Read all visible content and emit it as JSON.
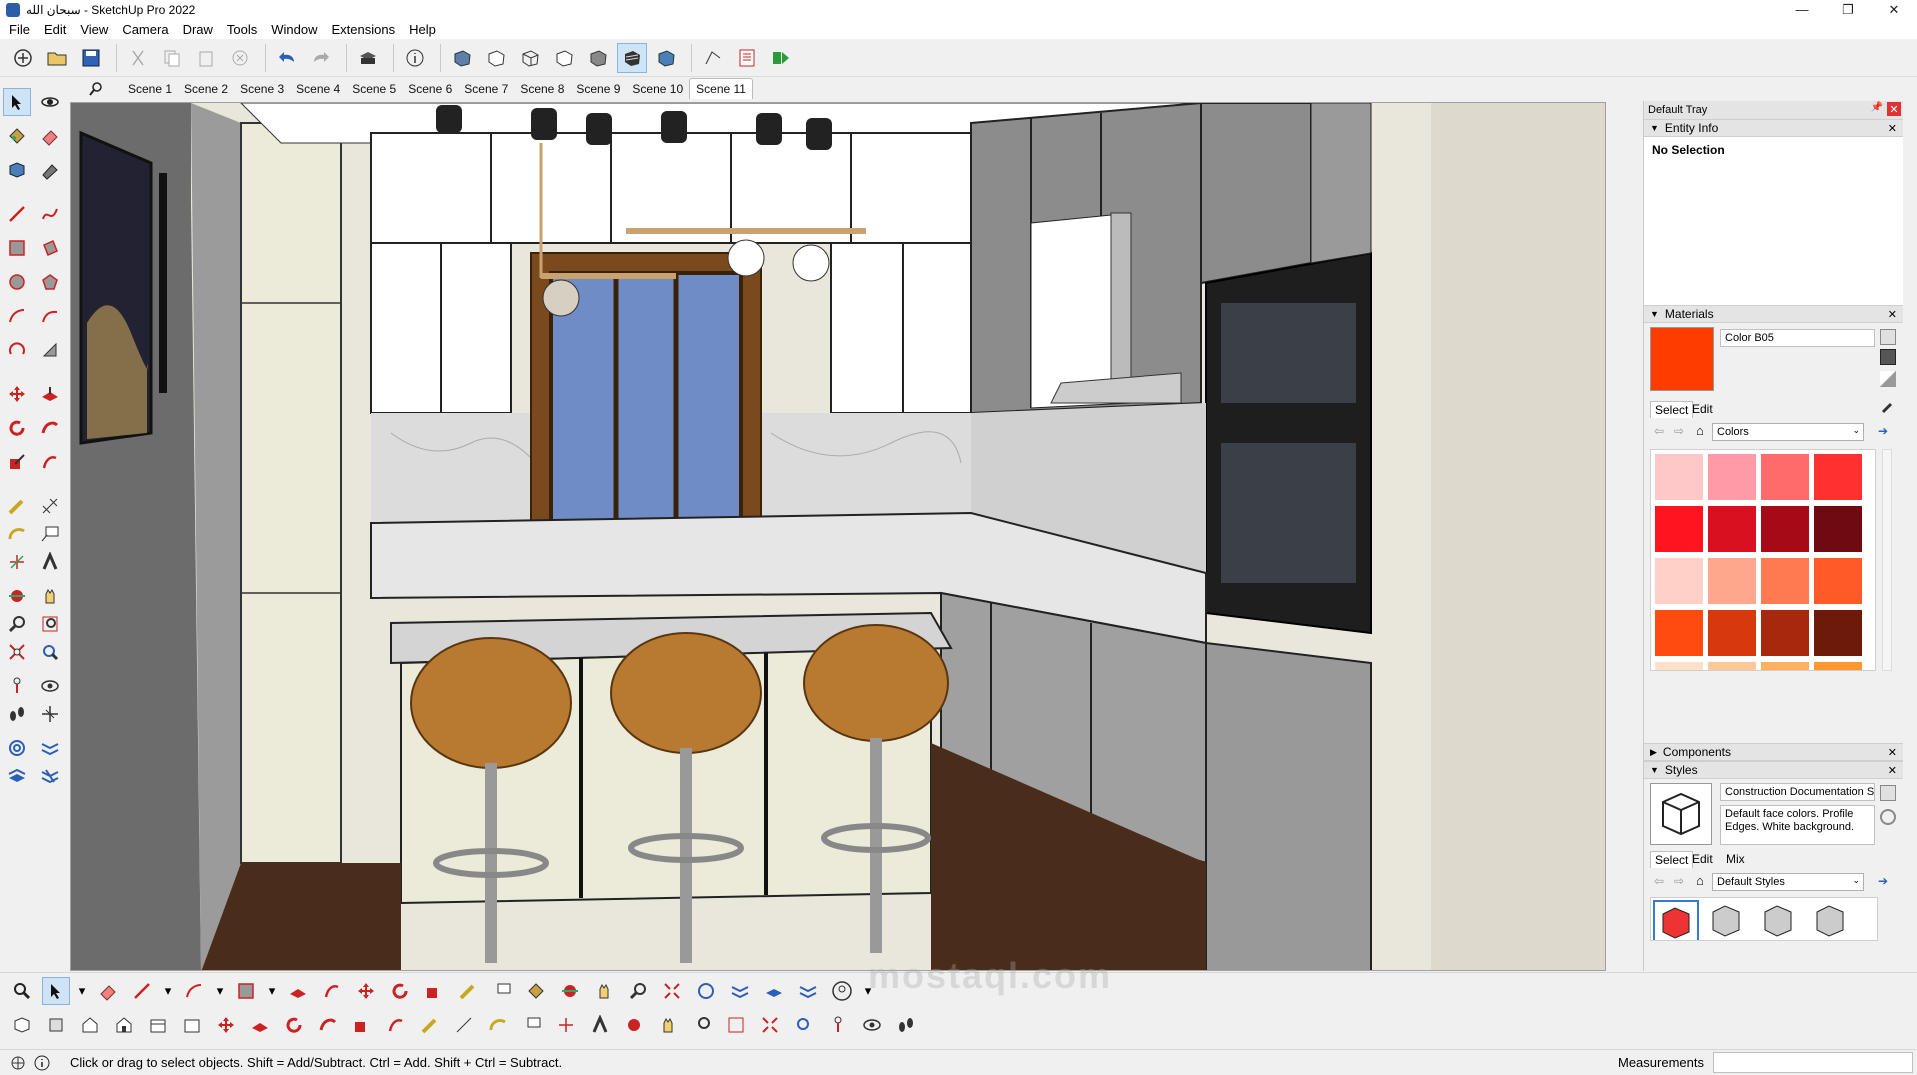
{
  "window": {
    "title": "سبحان الله - SketchUp Pro 2022",
    "min": "—",
    "max": "❐",
    "close": "✕"
  },
  "menu": [
    "File",
    "Edit",
    "View",
    "Camera",
    "Draw",
    "Tools",
    "Window",
    "Extensions",
    "Help"
  ],
  "scenes": [
    "Scene 1",
    "Scene 2",
    "Scene 3",
    "Scene 4",
    "Scene 5",
    "Scene 6",
    "Scene 7",
    "Scene 8",
    "Scene 9",
    "Scene 10",
    "Scene 11"
  ],
  "active_scene": "Scene 11",
  "tray": {
    "title": "Default Tray",
    "entity_info": {
      "header": "Entity Info",
      "selection": "No Selection"
    },
    "materials": {
      "header": "Materials",
      "current_name": "Color B05",
      "current_color": "#ff3c00",
      "tabs": [
        "Select",
        "Edit"
      ],
      "library": "Colors",
      "swatches": [
        "#ffc8c8",
        "#ff9aa6",
        "#ff6b6b",
        "#ff3030",
        "#ff1420",
        "#d81020",
        "#a60a16",
        "#6e0a10",
        "#ffd0c8",
        "#ffa78c",
        "#ff7a50",
        "#ff5a28",
        "#ff4a10",
        "#d8380e",
        "#a8280e",
        "#6e1a0a",
        "#ffe0c8",
        "#ffc896",
        "#ffb060",
        "#ff9830"
      ]
    },
    "components": {
      "header": "Components"
    },
    "styles": {
      "header": "Styles",
      "style_name": "Construction Documentation St",
      "description": "Default face colors. Profile Edges. White background.",
      "tabs": [
        "Select",
        "Edit",
        "Mix"
      ],
      "library": "Default Styles"
    }
  },
  "status": {
    "hint": "Click or drag to select objects. Shift = Add/Subtract. Ctrl = Add. Shift + Ctrl = Subtract.",
    "measurements_label": "Measurements",
    "measurements_value": ""
  },
  "watermark": "mostaql.com"
}
